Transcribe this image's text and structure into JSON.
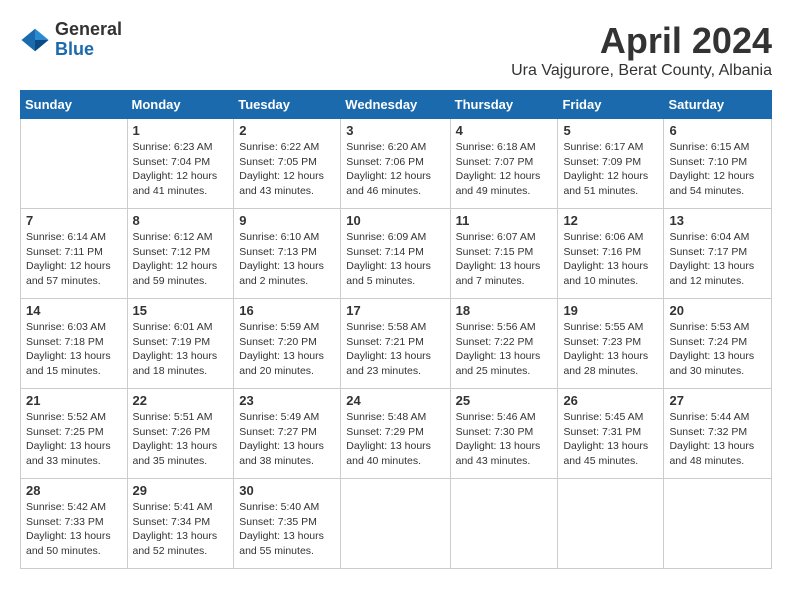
{
  "header": {
    "logo_general": "General",
    "logo_blue": "Blue",
    "month_title": "April 2024",
    "subtitle": "Ura Vajgurore, Berat County, Albania"
  },
  "days_of_week": [
    "Sunday",
    "Monday",
    "Tuesday",
    "Wednesday",
    "Thursday",
    "Friday",
    "Saturday"
  ],
  "weeks": [
    [
      {
        "day": "",
        "sunrise": "",
        "sunset": "",
        "daylight": ""
      },
      {
        "day": "1",
        "sunrise": "Sunrise: 6:23 AM",
        "sunset": "Sunset: 7:04 PM",
        "daylight": "Daylight: 12 hours and 41 minutes."
      },
      {
        "day": "2",
        "sunrise": "Sunrise: 6:22 AM",
        "sunset": "Sunset: 7:05 PM",
        "daylight": "Daylight: 12 hours and 43 minutes."
      },
      {
        "day": "3",
        "sunrise": "Sunrise: 6:20 AM",
        "sunset": "Sunset: 7:06 PM",
        "daylight": "Daylight: 12 hours and 46 minutes."
      },
      {
        "day": "4",
        "sunrise": "Sunrise: 6:18 AM",
        "sunset": "Sunset: 7:07 PM",
        "daylight": "Daylight: 12 hours and 49 minutes."
      },
      {
        "day": "5",
        "sunrise": "Sunrise: 6:17 AM",
        "sunset": "Sunset: 7:09 PM",
        "daylight": "Daylight: 12 hours and 51 minutes."
      },
      {
        "day": "6",
        "sunrise": "Sunrise: 6:15 AM",
        "sunset": "Sunset: 7:10 PM",
        "daylight": "Daylight: 12 hours and 54 minutes."
      }
    ],
    [
      {
        "day": "7",
        "sunrise": "Sunrise: 6:14 AM",
        "sunset": "Sunset: 7:11 PM",
        "daylight": "Daylight: 12 hours and 57 minutes."
      },
      {
        "day": "8",
        "sunrise": "Sunrise: 6:12 AM",
        "sunset": "Sunset: 7:12 PM",
        "daylight": "Daylight: 12 hours and 59 minutes."
      },
      {
        "day": "9",
        "sunrise": "Sunrise: 6:10 AM",
        "sunset": "Sunset: 7:13 PM",
        "daylight": "Daylight: 13 hours and 2 minutes."
      },
      {
        "day": "10",
        "sunrise": "Sunrise: 6:09 AM",
        "sunset": "Sunset: 7:14 PM",
        "daylight": "Daylight: 13 hours and 5 minutes."
      },
      {
        "day": "11",
        "sunrise": "Sunrise: 6:07 AM",
        "sunset": "Sunset: 7:15 PM",
        "daylight": "Daylight: 13 hours and 7 minutes."
      },
      {
        "day": "12",
        "sunrise": "Sunrise: 6:06 AM",
        "sunset": "Sunset: 7:16 PM",
        "daylight": "Daylight: 13 hours and 10 minutes."
      },
      {
        "day": "13",
        "sunrise": "Sunrise: 6:04 AM",
        "sunset": "Sunset: 7:17 PM",
        "daylight": "Daylight: 13 hours and 12 minutes."
      }
    ],
    [
      {
        "day": "14",
        "sunrise": "Sunrise: 6:03 AM",
        "sunset": "Sunset: 7:18 PM",
        "daylight": "Daylight: 13 hours and 15 minutes."
      },
      {
        "day": "15",
        "sunrise": "Sunrise: 6:01 AM",
        "sunset": "Sunset: 7:19 PM",
        "daylight": "Daylight: 13 hours and 18 minutes."
      },
      {
        "day": "16",
        "sunrise": "Sunrise: 5:59 AM",
        "sunset": "Sunset: 7:20 PM",
        "daylight": "Daylight: 13 hours and 20 minutes."
      },
      {
        "day": "17",
        "sunrise": "Sunrise: 5:58 AM",
        "sunset": "Sunset: 7:21 PM",
        "daylight": "Daylight: 13 hours and 23 minutes."
      },
      {
        "day": "18",
        "sunrise": "Sunrise: 5:56 AM",
        "sunset": "Sunset: 7:22 PM",
        "daylight": "Daylight: 13 hours and 25 minutes."
      },
      {
        "day": "19",
        "sunrise": "Sunrise: 5:55 AM",
        "sunset": "Sunset: 7:23 PM",
        "daylight": "Daylight: 13 hours and 28 minutes."
      },
      {
        "day": "20",
        "sunrise": "Sunrise: 5:53 AM",
        "sunset": "Sunset: 7:24 PM",
        "daylight": "Daylight: 13 hours and 30 minutes."
      }
    ],
    [
      {
        "day": "21",
        "sunrise": "Sunrise: 5:52 AM",
        "sunset": "Sunset: 7:25 PM",
        "daylight": "Daylight: 13 hours and 33 minutes."
      },
      {
        "day": "22",
        "sunrise": "Sunrise: 5:51 AM",
        "sunset": "Sunset: 7:26 PM",
        "daylight": "Daylight: 13 hours and 35 minutes."
      },
      {
        "day": "23",
        "sunrise": "Sunrise: 5:49 AM",
        "sunset": "Sunset: 7:27 PM",
        "daylight": "Daylight: 13 hours and 38 minutes."
      },
      {
        "day": "24",
        "sunrise": "Sunrise: 5:48 AM",
        "sunset": "Sunset: 7:29 PM",
        "daylight": "Daylight: 13 hours and 40 minutes."
      },
      {
        "day": "25",
        "sunrise": "Sunrise: 5:46 AM",
        "sunset": "Sunset: 7:30 PM",
        "daylight": "Daylight: 13 hours and 43 minutes."
      },
      {
        "day": "26",
        "sunrise": "Sunrise: 5:45 AM",
        "sunset": "Sunset: 7:31 PM",
        "daylight": "Daylight: 13 hours and 45 minutes."
      },
      {
        "day": "27",
        "sunrise": "Sunrise: 5:44 AM",
        "sunset": "Sunset: 7:32 PM",
        "daylight": "Daylight: 13 hours and 48 minutes."
      }
    ],
    [
      {
        "day": "28",
        "sunrise": "Sunrise: 5:42 AM",
        "sunset": "Sunset: 7:33 PM",
        "daylight": "Daylight: 13 hours and 50 minutes."
      },
      {
        "day": "29",
        "sunrise": "Sunrise: 5:41 AM",
        "sunset": "Sunset: 7:34 PM",
        "daylight": "Daylight: 13 hours and 52 minutes."
      },
      {
        "day": "30",
        "sunrise": "Sunrise: 5:40 AM",
        "sunset": "Sunset: 7:35 PM",
        "daylight": "Daylight: 13 hours and 55 minutes."
      },
      {
        "day": "",
        "sunrise": "",
        "sunset": "",
        "daylight": ""
      },
      {
        "day": "",
        "sunrise": "",
        "sunset": "",
        "daylight": ""
      },
      {
        "day": "",
        "sunrise": "",
        "sunset": "",
        "daylight": ""
      },
      {
        "day": "",
        "sunrise": "",
        "sunset": "",
        "daylight": ""
      }
    ]
  ]
}
